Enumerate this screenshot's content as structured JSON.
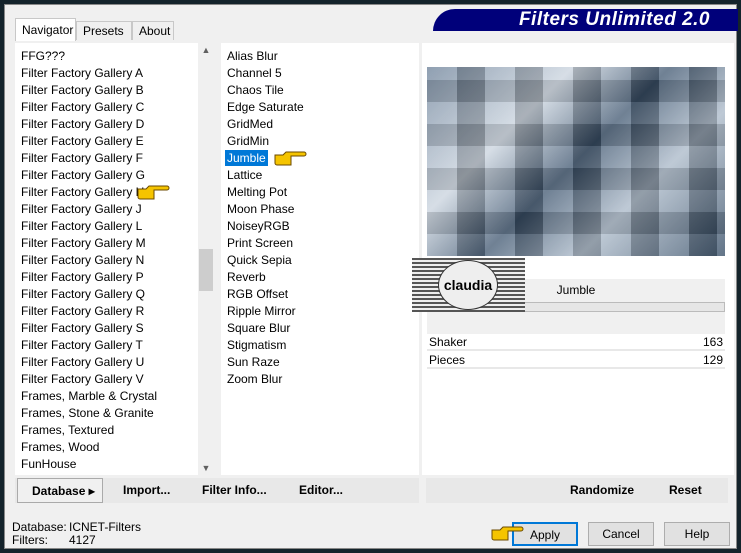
{
  "title": "Filters Unlimited 2.0",
  "tabs": [
    "Navigator",
    "Presets",
    "About"
  ],
  "categories": [
    "FFG???",
    "Filter Factory Gallery A",
    "Filter Factory Gallery B",
    "Filter Factory Gallery C",
    "Filter Factory Gallery D",
    "Filter Factory Gallery E",
    "Filter Factory Gallery F",
    "Filter Factory Gallery G",
    "Filter Factory Gallery H",
    "Filter Factory Gallery J",
    "Filter Factory Gallery L",
    "Filter Factory Gallery M",
    "Filter Factory Gallery N",
    "Filter Factory Gallery P",
    "Filter Factory Gallery Q",
    "Filter Factory Gallery R",
    "Filter Factory Gallery S",
    "Filter Factory Gallery T",
    "Filter Factory Gallery U",
    "Filter Factory Gallery V",
    "Frames, Marble & Crystal",
    "Frames, Stone & Granite",
    "Frames, Textured",
    "Frames, Wood",
    "FunHouse"
  ],
  "filters": [
    "Alias Blur",
    "Channel 5",
    "Chaos Tile",
    "Edge Saturate",
    "GridMed",
    "GridMin",
    "Jumble",
    "Lattice",
    "Melting Pot",
    "Moon Phase",
    "NoiseyRGB",
    "Print Screen",
    "Quick Sepia",
    "Reverb",
    "RGB Offset",
    "Ripple Mirror",
    "Square Blur",
    "Stigmatism",
    "Sun Raze",
    "Zoom Blur"
  ],
  "selected_filter": "Jumble",
  "watermark": "claudia",
  "params": [
    {
      "label": "Shaker",
      "value": "163"
    },
    {
      "label": "Pieces",
      "value": "129"
    }
  ],
  "toolbar": {
    "database": "Database",
    "import": "Import...",
    "filter_info": "Filter Info...",
    "editor": "Editor...",
    "randomize": "Randomize",
    "reset": "Reset"
  },
  "status": {
    "database_label": "Database:",
    "database_value": "ICNET-Filters",
    "filters_label": "Filters:",
    "filters_value": "4127"
  },
  "buttons": {
    "apply": "Apply",
    "cancel": "Cancel",
    "help": "Help"
  },
  "colors": {
    "banner": "#00007a",
    "selection": "#0078d7",
    "pointer_hand": "#f5c400"
  }
}
